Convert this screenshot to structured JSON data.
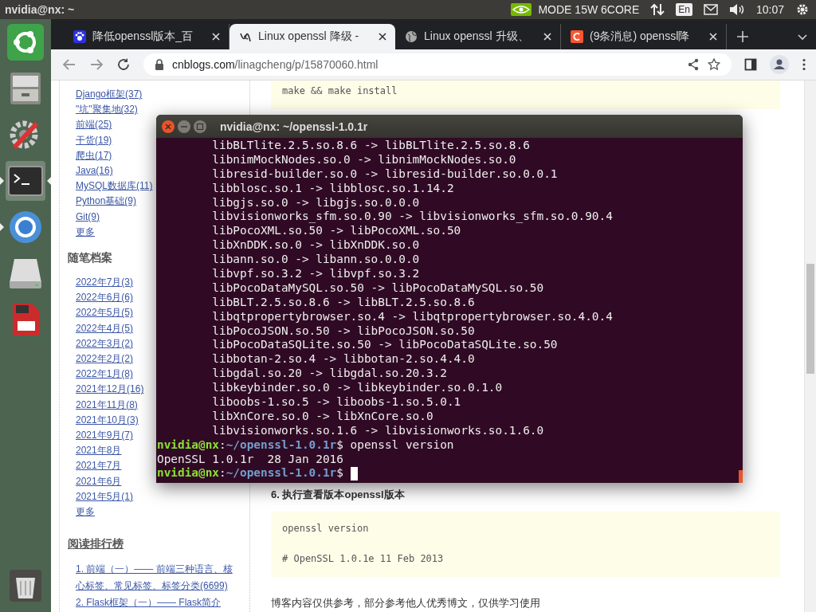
{
  "top_panel": {
    "title": "nvidia@nx: ~",
    "mode": "MODE 15W 6CORE",
    "keyboard": "En",
    "time": "10:07"
  },
  "launcher": {
    "items": [
      {
        "kind": "ubuntu",
        "running": false,
        "selected": false
      },
      {
        "kind": "files",
        "running": false,
        "selected": false
      },
      {
        "kind": "settings",
        "running": false,
        "selected": false
      },
      {
        "kind": "terminal",
        "running": true,
        "selected": true
      },
      {
        "kind": "browser",
        "running": true,
        "selected": false
      },
      {
        "kind": "drive",
        "running": false,
        "selected": false
      },
      {
        "kind": "sdcard",
        "running": false,
        "selected": false
      }
    ],
    "trash": {
      "kind": "trash"
    }
  },
  "browser": {
    "tabs": [
      {
        "kind": "paw",
        "title": "降低openssl版本_百",
        "selected": false
      },
      {
        "kind": "cnblogs",
        "title": "Linux openssl 降级 -",
        "selected": true
      },
      {
        "kind": "globe",
        "title": "Linux openssl 升级、",
        "selected": false
      },
      {
        "kind": "csdn",
        "title": "(9条消息) openssl降",
        "selected": false
      }
    ],
    "address": {
      "domain": "cnblogs.com",
      "path": "/linagcheng/p/15870060.html"
    }
  },
  "sidebar": {
    "categories": [
      "Django框架(37)",
      "\"坑\"聚集地(32)",
      "前端(25)",
      "干货(19)",
      "爬虫(17)",
      "Java(16)",
      "MySQL数据库(11)",
      "Python基础(9)",
      "Git(9)"
    ],
    "more_categories": "更多",
    "archive_title": "随笔档案",
    "archives": [
      "2022年7月(3)",
      "2022年6月(6)",
      "2022年5月(5)",
      "2022年4月(5)",
      "2022年3月(2)",
      "2022年2月(2)",
      "2022年1月(8)",
      "2021年12月(16)",
      "2021年11月(8)",
      "2021年10月(3)",
      "2021年9月(7)",
      "2021年8月",
      "2021年7月",
      "2021年6月",
      "2021年5月(1)"
    ],
    "more_archives": "更多",
    "ranking_title": "阅读排行榜",
    "ranking": [
      "1. 前端（一）—— 前端三种语言、核心标签、常见标签、标签分类(6699)",
      "2. Flask框架（一）—— Flask简介"
    ]
  },
  "article": {
    "top_code": "make && make install",
    "heading": "6. 执行查看版本openssl版本",
    "code": [
      "openssl version",
      "# OpenSSL 1.0.1e 11 Feb 2013"
    ],
    "footer": "博客内容仅供参考，部分参考他人优秀博文，仅供学习使用"
  },
  "terminal": {
    "title": "nvidia@nx: ~/openssl-1.0.1r",
    "lines": [
      {
        "kind": "output",
        "text": "        libBLTlite.2.5.so.8.6 -> libBLTlite.2.5.so.8.6"
      },
      {
        "kind": "output",
        "text": "        libnimMockNodes.so.0 -> libnimMockNodes.so.0"
      },
      {
        "kind": "output",
        "text": "        libresid-builder.so.0 -> libresid-builder.so.0.0.1"
      },
      {
        "kind": "output",
        "text": "        libblosc.so.1 -> libblosc.so.1.14.2"
      },
      {
        "kind": "output",
        "text": "        libgjs.so.0 -> libgjs.so.0.0.0"
      },
      {
        "kind": "output",
        "text": "        libvisionworks_sfm.so.0.90 -> libvisionworks_sfm.so.0.90.4"
      },
      {
        "kind": "output",
        "text": "        libPocoXML.so.50 -> libPocoXML.so.50"
      },
      {
        "kind": "output",
        "text": "        libXnDDK.so.0 -> libXnDDK.so.0"
      },
      {
        "kind": "output",
        "text": "        libann.so.0 -> libann.so.0.0.0"
      },
      {
        "kind": "output",
        "text": "        libvpf.so.3.2 -> libvpf.so.3.2"
      },
      {
        "kind": "output",
        "text": "        libPocoDataMySQL.so.50 -> libPocoDataMySQL.so.50"
      },
      {
        "kind": "output",
        "text": "        libBLT.2.5.so.8.6 -> libBLT.2.5.so.8.6"
      },
      {
        "kind": "output",
        "text": "        libqtpropertybrowser.so.4 -> libqtpropertybrowser.so.4.0.4"
      },
      {
        "kind": "output",
        "text": "        libPocoJSON.so.50 -> libPocoJSON.so.50"
      },
      {
        "kind": "output",
        "text": "        libPocoDataSQLite.so.50 -> libPocoDataSQLite.so.50"
      },
      {
        "kind": "output",
        "text": "        libbotan-2.so.4 -> libbotan-2.so.4.4.0"
      },
      {
        "kind": "output",
        "text": "        libgdal.so.20 -> libgdal.so.20.3.2"
      },
      {
        "kind": "output",
        "text": "        libkeybinder.so.0 -> libkeybinder.so.0.1.0"
      },
      {
        "kind": "output",
        "text": "        liboobs-1.so.5 -> liboobs-1.so.5.0.1"
      },
      {
        "kind": "output",
        "text": "        libXnCore.so.0 -> libXnCore.so.0"
      },
      {
        "kind": "output",
        "text": "        libvisionworks.so.1.6 -> libvisionworks.so.1.6.0"
      },
      {
        "kind": "prompt",
        "user": "nvidia@nx",
        "sep": ":",
        "path": "~/openssl-1.0.1r",
        "symbol": "$",
        "command": "openssl version"
      },
      {
        "kind": "output",
        "text": "OpenSSL 1.0.1r  28 Jan 2016"
      },
      {
        "kind": "prompt",
        "user": "nvidia@nx",
        "sep": ":",
        "path": "~/openssl-1.0.1r",
        "symbol": "$"
      }
    ]
  }
}
